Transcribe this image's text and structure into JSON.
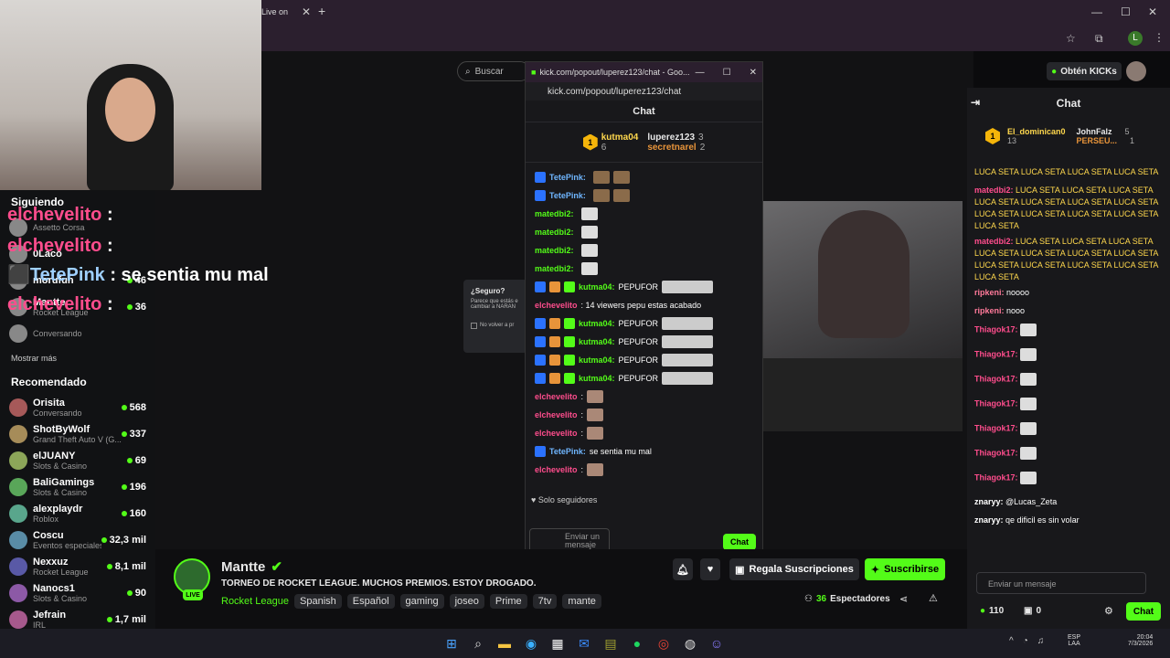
{
  "browser": {
    "tab_title": "Live on",
    "new_tab": "+",
    "profile_initial": "L"
  },
  "search": {
    "placeholder": "Buscar"
  },
  "topright": {
    "kicks_label": "Obtén KICKs"
  },
  "popout": {
    "title": "kick.com/popout/luperez123/chat - Goo...",
    "url": "kick.com/popout/luperez123/chat",
    "chat_header": "Chat",
    "top_gifters": [
      {
        "rank": "1",
        "name": "kutma04",
        "count": "6"
      },
      {
        "name": "luperez123",
        "count": "3"
      },
      {
        "name": "secretnarel",
        "count": "2"
      }
    ],
    "messages": [
      {
        "user": "TetePink:",
        "text": ""
      },
      {
        "user": "TetePink:",
        "text": ""
      },
      {
        "user": "matedbi2:",
        "text": ""
      },
      {
        "user": "matedbi2:",
        "text": ""
      },
      {
        "user": "matedbi2:",
        "text": ""
      },
      {
        "user": "matedbi2:",
        "text": ""
      },
      {
        "user": "kutma04:",
        "text": "PEPUFOR"
      },
      {
        "user": "elchevelito",
        "text": ": 14 viewers pepu estas acabado"
      },
      {
        "user": "kutma04:",
        "text": "PEPUFOR"
      },
      {
        "user": "kutma04:",
        "text": "PEPUFOR"
      },
      {
        "user": "kutma04:",
        "text": "PEPUFOR"
      },
      {
        "user": "kutma04:",
        "text": "PEPUFOR"
      },
      {
        "user": "elchevelito",
        "text": ":"
      },
      {
        "user": "elchevelito",
        "text": ":"
      },
      {
        "user": "elchevelito",
        "text": ":"
      },
      {
        "user": "TetePink:",
        "text": "se sentia mu mal"
      },
      {
        "user": "elchevelito",
        "text": ":"
      }
    ],
    "followers_only": "Solo seguidores",
    "send_placeholder": "Enviar un mensaje",
    "chat_button": "Chat"
  },
  "overlay": {
    "lines": [
      {
        "user": "elchevelito",
        "text": " :"
      },
      {
        "user": "elchevelito",
        "text": " :"
      },
      {
        "user": "TetePink",
        "text": " : se sentia mu mal"
      },
      {
        "user": "elchevelito",
        "text": " :"
      }
    ]
  },
  "sidebar": {
    "following_title": "Siguiendo",
    "following": [
      {
        "name": "",
        "sub": "Assetto Corsa",
        "count": ""
      },
      {
        "name": "0Laco",
        "sub": "",
        "count": ""
      },
      {
        "name": "morufun",
        "sub": "",
        "count": "46"
      },
      {
        "name": "Mantte",
        "sub": "Rocket League",
        "count": "36"
      },
      {
        "name": "",
        "sub": "Conversando",
        "count": ""
      }
    ],
    "show_more": "Mostrar más",
    "recommended_title": "Recomendado",
    "recommended": [
      {
        "name": "Orisita",
        "sub": "Conversando",
        "count": "568"
      },
      {
        "name": "ShotByWolf",
        "sub": "Grand Theft Auto V (G...",
        "count": "337"
      },
      {
        "name": "elJUANY",
        "sub": "Slots & Casino",
        "count": "69"
      },
      {
        "name": "BaliGamings",
        "sub": "Slots & Casino",
        "count": "196"
      },
      {
        "name": "alexplaydr",
        "sub": "Roblox",
        "count": "160"
      },
      {
        "name": "Coscu",
        "sub": "Eventos especiales",
        "count": "32,3 mil"
      },
      {
        "name": "Nexxuz",
        "sub": "Rocket League",
        "count": "8,1 mil"
      },
      {
        "name": "Nanocs1",
        "sub": "Slots & Casino",
        "count": "90"
      },
      {
        "name": "Jefrain",
        "sub": "IRL",
        "count": "1,7 mil"
      }
    ]
  },
  "dialog": {
    "title": "¿Seguro?",
    "body": "Parece que estás e cambiar a NARAN",
    "checkbox": "No volver a pr"
  },
  "stream": {
    "live_badge": "LIVE",
    "channel": "Mantte",
    "title": "TORNEO DE ROCKET LEAGUE. MUCHOS PREMIOS. ESTOY DROGADO.",
    "category": "Rocket League",
    "tags": [
      "Spanish",
      "Español",
      "gaming",
      "joseo",
      "Prime",
      "7tv",
      "mante"
    ],
    "gift_subs": "Regala Suscripciones",
    "subscribe": "Suscribirse",
    "viewers": "36",
    "viewers_label": "Espectadores"
  },
  "right_chat": {
    "title": "Chat",
    "top": [
      {
        "rank": "1",
        "name": "El_dominican0",
        "count": "13"
      },
      {
        "name": "JohnFalz",
        "count": "5"
      },
      {
        "name": "PERSEU...",
        "count": "1"
      }
    ],
    "messages": [
      {
        "user": "",
        "text": "LUCA SETA LUCA SETA LUCA SETA LUCA SETA"
      },
      {
        "user": "matedbi2:",
        "text": "LUCA SETA LUCA SETA LUCA SETA LUCA SETA LUCA SETA LUCA SETA LUCA SETA LUCA SETA LUCA SETA LUCA SETA LUCA SETA LUCA SETA"
      },
      {
        "user": "matedbi2:",
        "text": "LUCA SETA LUCA SETA LUCA SETA LUCA SETA LUCA SETA LUCA SETA LUCA SETA LUCA SETA LUCA SETA LUCA SETA LUCA SETA LUCA SETA"
      },
      {
        "user": "ripkeni:",
        "text": "noooo"
      },
      {
        "user": "ripkeni:",
        "text": "nooo"
      },
      {
        "user": "Thiagok17:",
        "text": ""
      },
      {
        "user": "Thiagok17:",
        "text": ""
      },
      {
        "user": "Thiagok17:",
        "text": ""
      },
      {
        "user": "Thiagok17:",
        "text": ""
      },
      {
        "user": "Thiagok17:",
        "text": ""
      },
      {
        "user": "Thiagok17:",
        "text": ""
      },
      {
        "user": "Thiagok17:",
        "text": ""
      },
      {
        "user": "znaryy:",
        "text": "@Lucas_Zeta"
      },
      {
        "user": "znaryy:",
        "text": "qe dificil es sin volar"
      }
    ],
    "send_placeholder": "Enviar un mensaje",
    "kicks_count": "110",
    "gift_count": "0",
    "chat_button": "Chat"
  },
  "taskbar": {
    "lang": "ESP",
    "layout": "LAA",
    "time": "20:04",
    "date": "7/3/2026"
  },
  "colors": {
    "kick_green": "#53fc18",
    "username_pink": "#ff4d8d",
    "bg": "#0b0b0d"
  }
}
